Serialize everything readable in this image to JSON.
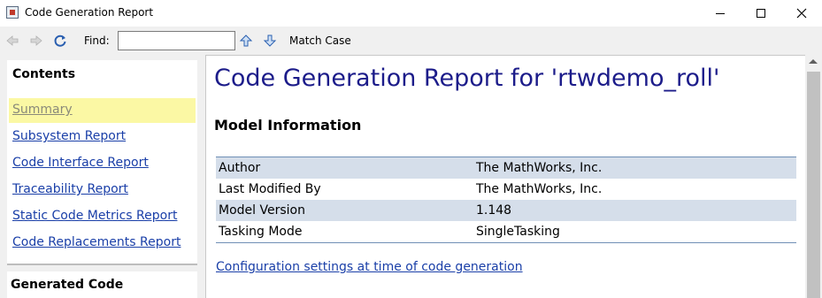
{
  "window": {
    "title": "Code Generation Report"
  },
  "toolbar": {
    "find_label": "Find:",
    "find_value": "",
    "match_case_label": "Match Case"
  },
  "sidebar": {
    "heading": "Contents",
    "items": [
      {
        "label": "Summary",
        "active": true
      },
      {
        "label": "Subsystem Report"
      },
      {
        "label": "Code Interface Report"
      },
      {
        "label": "Traceability Report"
      },
      {
        "label": "Static Code Metrics Report"
      },
      {
        "label": "Code Replacements Report"
      }
    ],
    "generated_code_heading": "Generated Code"
  },
  "main": {
    "title": "Code Generation Report for 'rtwdemo_roll'",
    "section_title": "Model Information",
    "info_rows": [
      {
        "key": "Author",
        "value": "The MathWorks, Inc."
      },
      {
        "key": "Last Modified By",
        "value": "The MathWorks, Inc."
      },
      {
        "key": "Model Version",
        "value": "1.148"
      },
      {
        "key": "Tasking Mode",
        "value": "SingleTasking"
      }
    ],
    "config_link": "Configuration settings at time of code generation"
  },
  "colors": {
    "title_color": "#1c1c8a",
    "link_color": "#1a3fa8",
    "active_highlight": "#fbf8a4",
    "row_shade": "#d5deea"
  }
}
